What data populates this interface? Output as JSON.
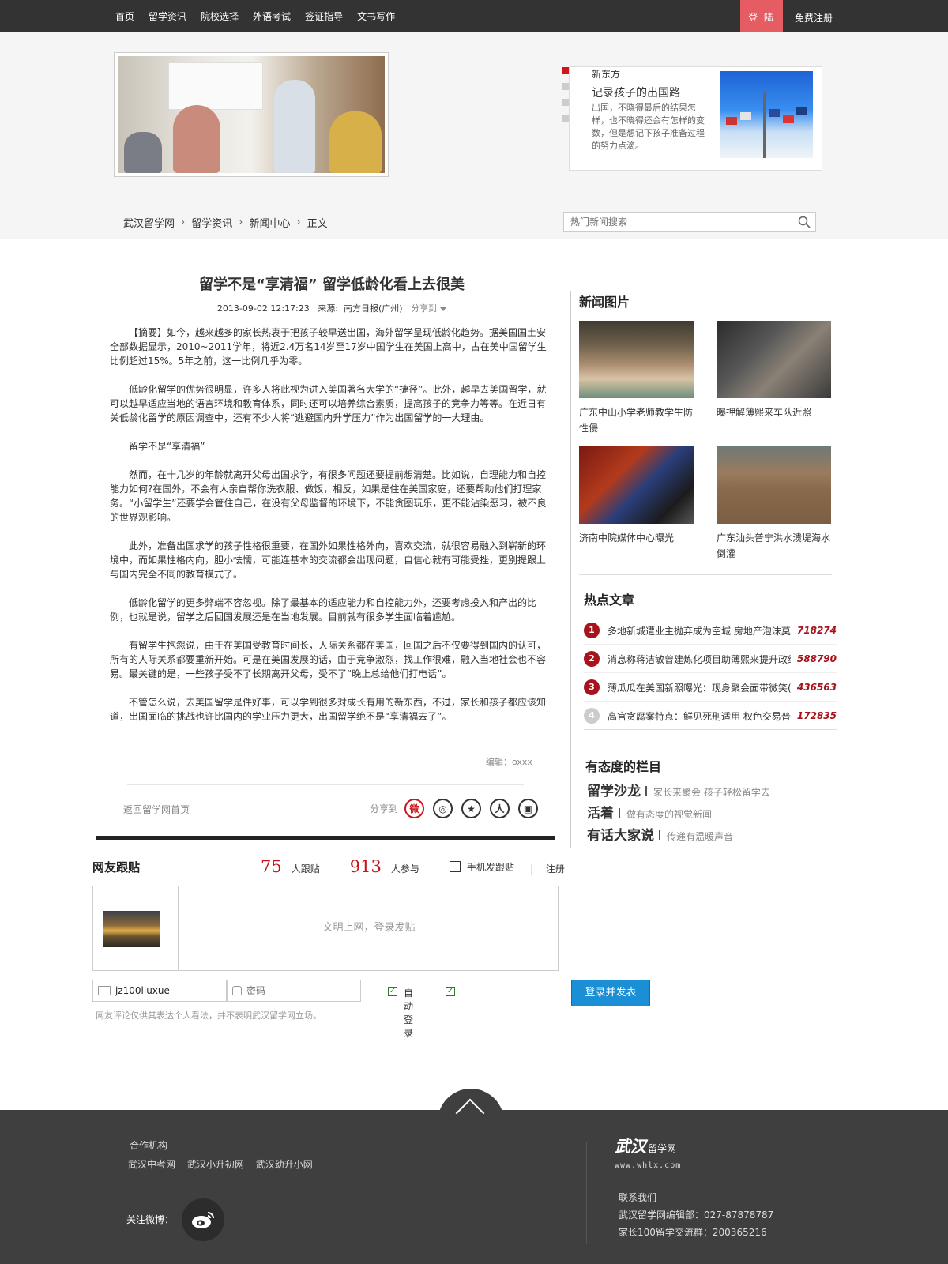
{
  "nav": {
    "items": [
      "首页",
      "留学资讯",
      "院校选择",
      "外语考试",
      "签证指导",
      "文书写作"
    ],
    "login": "登 陆",
    "register": "免费注册"
  },
  "feature": {
    "tag": "新东方",
    "title": "记录孩子的出国路",
    "desc": "出国，不晓得最后的结果怎样，也不晓得还会有怎样的变数，但是想记下孩子准备过程的努力点滴。"
  },
  "breadcrumb": [
    "武汉留学网",
    "留学资讯",
    "新闻中心",
    "正文"
  ],
  "search": {
    "placeholder": "热门新闻搜索"
  },
  "article": {
    "title": "留学不是“享清福” 留学低龄化看上去很美",
    "datetime": "2013-09-02 12:17:23",
    "source_label": "来源:",
    "source": "南方日报(广州)",
    "share_to": "分享到",
    "paragraphs": [
      "【摘要】如今，越来越多的家长热衷于把孩子较早送出国，海外留学呈现低龄化趋势。据美国国土安全部数据显示，2010~2011学年，将近2.4万名14岁至17岁中国学生在美国上高中，占在美中国留学生比例超过15%。5年之前，这一比例几乎为零。",
      "低龄化留学的优势很明显，许多人将此视为进入美国著名大学的“捷径”。此外，越早去美国留学，就可以越早适应当地的语言环境和教育体系，同时还可以培养综合素质，提高孩子的竞争力等等。在近日有关低龄化留学的原因调查中，还有不少人将“逃避国内升学压力”作为出国留学的一大理由。",
      "留学不是“享清福”",
      "然而，在十几岁的年龄就离开父母出国求学，有很多问题还要提前想清楚。比如说，自理能力和自控能力如何?在国外，不会有人亲自帮你洗衣服、做饭，相反，如果是住在美国家庭，还要帮助他们打理家务。“小留学生”还要学会管住自己，在没有父母监督的环境下，不能贪图玩乐，更不能沾染恶习，被不良的世界观影响。",
      "此外，准备出国求学的孩子性格很重要，在国外如果性格外向，喜欢交流，就很容易融入到崭新的环境中，而如果性格内向，胆小怯懦，可能连基本的交流都会出现问题，自信心就有可能受挫，更别提跟上与国内完全不同的教育模式了。",
      "低龄化留学的更多弊端不容忽视。除了最基本的适应能力和自控能力外，还要考虑投入和产出的比例，也就是说，留学之后回国发展还是在当地发展。目前就有很多学生面临着尴尬。",
      "有留学生抱怨说，由于在美国受教育时间长，人际关系都在美国，回国之后不仅要得到国内的认可，所有的人际关系都要重新开始。可是在美国发展的话，由于竞争激烈，找工作很难，融入当地社会也不容易。最关键的是，一些孩子受不了长期离开父母，受不了“晚上总给他们打电话”。",
      "不管怎么说，去美国留学是件好事，可以学到很多对成长有用的新东西，不过，家长和孩子都应该知道，出国面临的挑战也许比国内的学业压力更大，出国留学绝不是“享清福去了”。"
    ],
    "editor": "编辑：oxxx",
    "back_home": "返回留学网首页",
    "share_label": "分享到"
  },
  "comments": {
    "title": "网友跟贴",
    "post_count": "75",
    "post_label": "人跟贴",
    "join_count": "913",
    "join_label": "人参与",
    "mobile": "手机发跟贴",
    "register": "注册",
    "placeholder": "文明上网，登录发贴",
    "username": "jz100liuxue",
    "password_placeholder": "密码",
    "auto_login": "自动登录",
    "submit": "登录并发表",
    "disclaimer": "网友评论仅供其表达个人看法，并不表明武汉留学网立场。"
  },
  "sidebar": {
    "news_pics_title": "新闻图片",
    "news_pics": [
      "广东中山小学老师教学生防性侵",
      "曝押解薄熙来车队近照",
      "济南中院媒体中心曝光",
      "广东汕头普宁洪水溃堤海水倒灌"
    ],
    "hot_title": "热点文章",
    "hot": [
      {
        "rank": "1",
        "text": "多地新城遭业主抛弃成为空城 房地产泡沫莫",
        "count": "718274"
      },
      {
        "rank": "2",
        "text": "消息称蒋洁敏曾建炼化项目助薄熙来提升政绩",
        "count": "588790"
      },
      {
        "rank": "3",
        "text": "薄瓜瓜在美国新照曝光：现身聚会面带微笑(",
        "count": "436563"
      },
      {
        "rank": "4",
        "text": "高官贪腐案特点：鲜见死刑适用 权色交易普",
        "count": "172835"
      }
    ],
    "columns_title": "有态度的栏目",
    "columns": [
      {
        "name": "留学沙龙",
        "desc": "家长来聚会 孩子轻松留学去"
      },
      {
        "name": "活着",
        "desc": "做有态度的视觉新闻"
      },
      {
        "name": "有话大家说",
        "desc": "传递有温暖声音"
      }
    ]
  },
  "footer": {
    "partners_title": "合作机构",
    "partners": [
      "武汉中考网",
      "武汉小升初网",
      "武汉幼升小网"
    ],
    "follow_weibo": "关注微博：",
    "logo_big": "武汉",
    "logo_small": "留学网",
    "logo_url": "www.whlx.com",
    "contact_title": "联系我们",
    "contact_editor": "武汉留学网编辑部：027-87878787",
    "contact_group": "家长100留学交流群：200365216"
  },
  "colors": {
    "topbar": "#333333",
    "login_tab": "#e65c63",
    "accent_red": "#c4141c",
    "submit_blue": "#1b8fd6",
    "footer": "#3f3f3f"
  }
}
